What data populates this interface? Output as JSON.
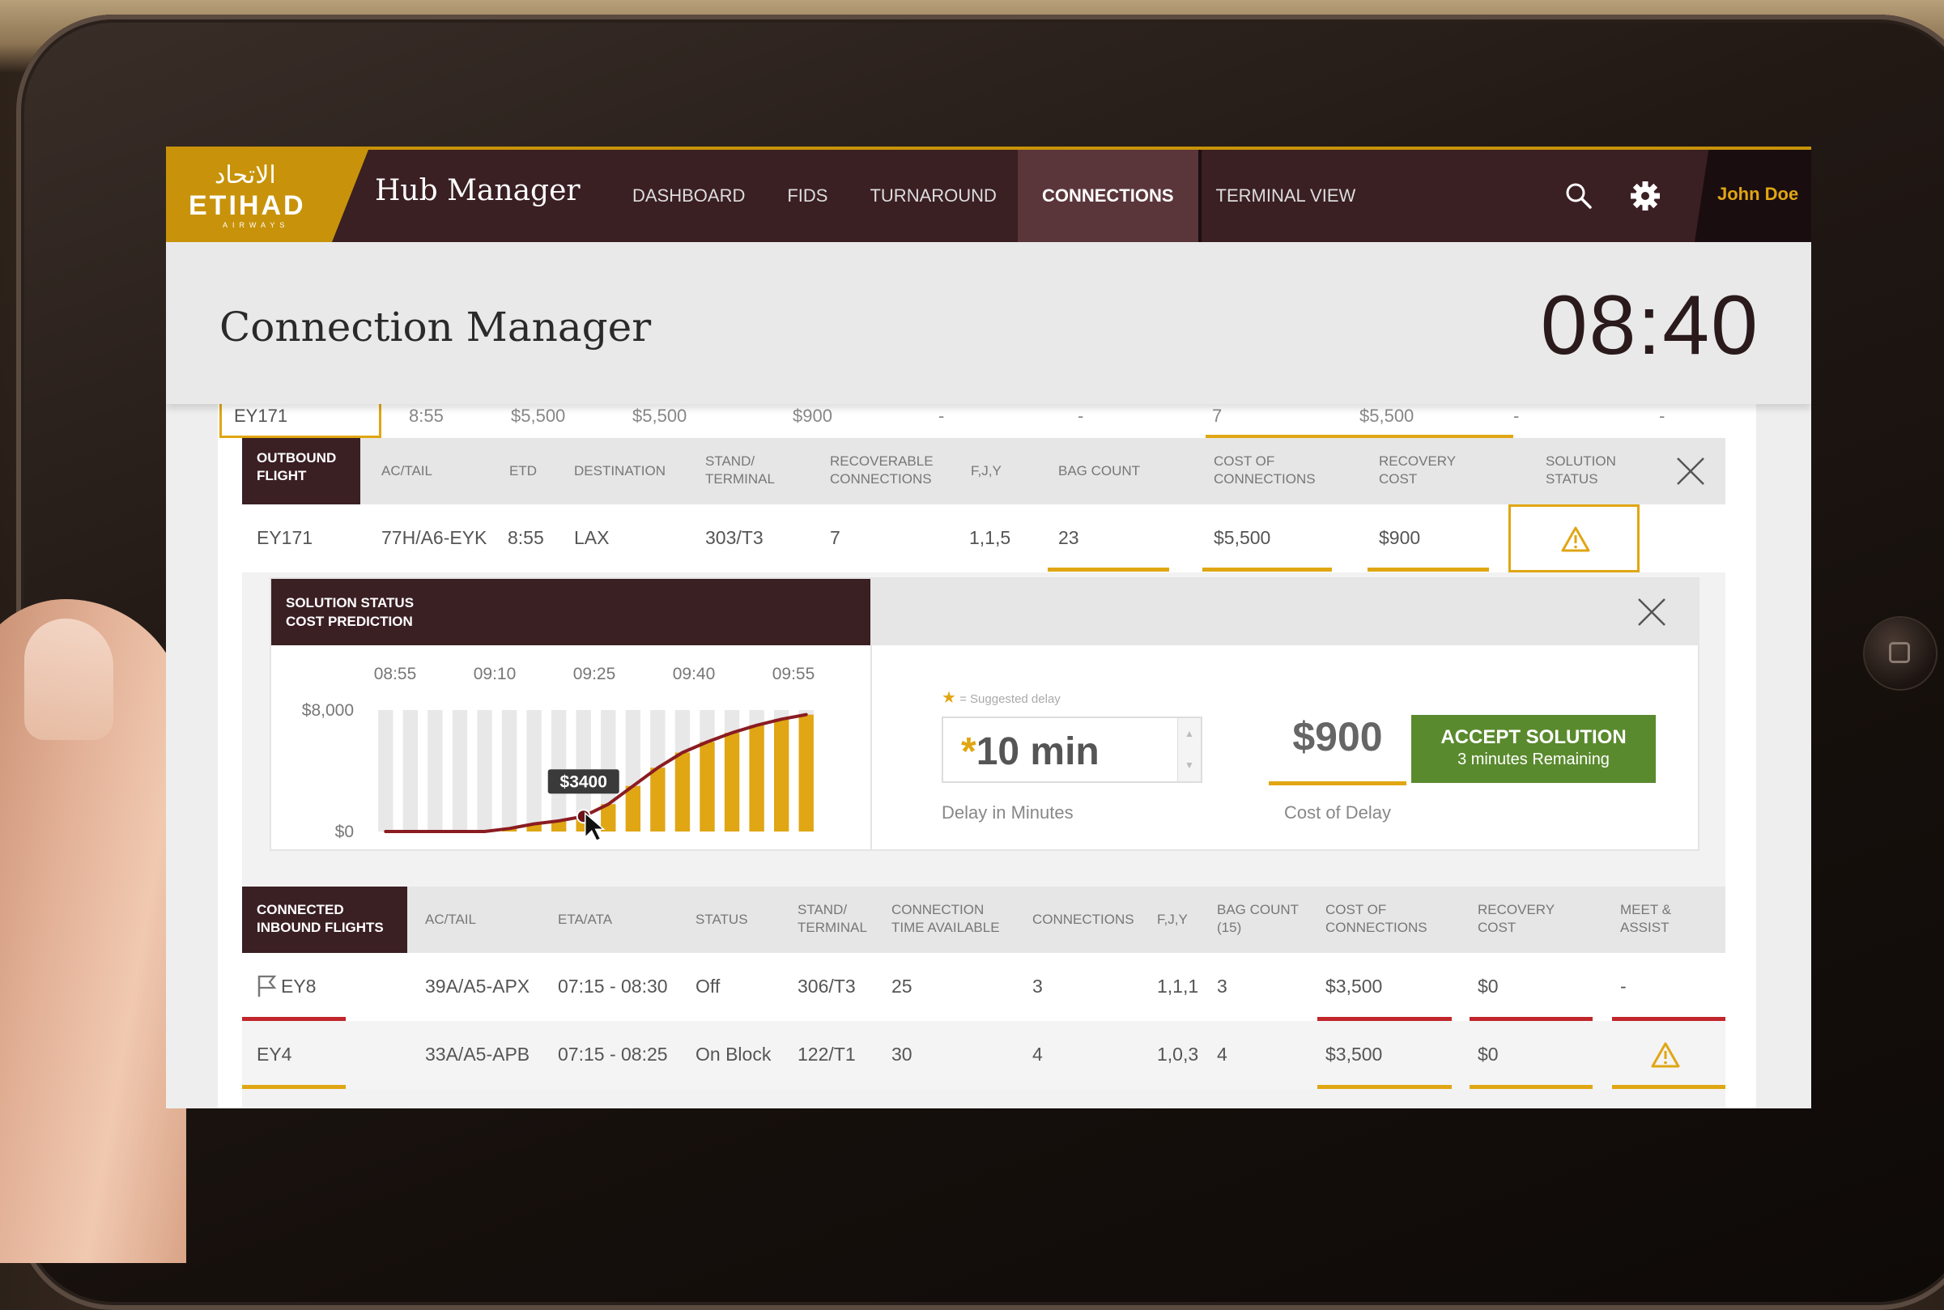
{
  "brand": {
    "logo_arabic": "الاتحاد",
    "logo_text": "ETIHAD",
    "logo_sub": "AIRWAYS",
    "app_name": "Hub Manager",
    "accent": "#c8930a"
  },
  "nav": {
    "items": [
      "DASHBOARD",
      "FIDS",
      "TURNAROUND",
      "CONNECTIONS",
      "TERMINAL VIEW"
    ],
    "active": "CONNECTIONS",
    "user": "John Doe"
  },
  "header": {
    "title": "Connection Manager",
    "time": "08:40"
  },
  "summary_row": [
    "EY171",
    "8:55",
    "$5,500",
    "$5,500",
    "$900",
    "-",
    "-",
    "7",
    "$5,500",
    "-",
    "-"
  ],
  "outbound": {
    "headers": [
      "OUTBOUND FLIGHT",
      "AC/TAIL",
      "ETD",
      "DESTINATION",
      "STAND/ TERMINAL",
      "RECOVERABLE CONNECTIONS",
      "F,J,Y",
      "BAG COUNT",
      "COST OF CONNECTIONS",
      "RECOVERY COST",
      "SOLUTION STATUS"
    ],
    "row": [
      "EY171",
      "77H/A6-EYK",
      "8:55",
      "LAX",
      "303/T3",
      "7",
      "1,1,5",
      "23",
      "$5,500",
      "$900"
    ]
  },
  "solution": {
    "title_line1": "SOLUTION STATUS",
    "title_line2": "COST PREDICTION",
    "legend_star": "★",
    "legend_text": "= Suggested delay",
    "delay_star": "*",
    "delay_value": "10 min",
    "delay_label": "Delay in Minutes",
    "cost_value": "$900",
    "cost_label": "Cost of Delay",
    "accept_label": "ACCEPT SOLUTION",
    "accept_sub": "3 minutes Remaining"
  },
  "chart_data": {
    "type": "bar",
    "x_ticks": [
      "08:55",
      "09:10",
      "09:25",
      "09:40",
      "09:55"
    ],
    "y_ticks": [
      "$8,000",
      "$0"
    ],
    "ylim": [
      0,
      8000
    ],
    "bar_count": 18,
    "values": [
      0,
      0,
      0,
      0,
      0,
      200,
      500,
      700,
      1000,
      1800,
      3000,
      4200,
      5200,
      5900,
      6500,
      7000,
      7400,
      7700
    ],
    "callout": "$3400",
    "callout_index": 8,
    "colors": {
      "bar": "#e0a613",
      "background_bar": "#e8e8e8",
      "curve": "#8a1c22"
    }
  },
  "inbound": {
    "headers": [
      "CONNECTED INBOUND FLIGHTS",
      "AC/TAIL",
      "ETA/ATA",
      "STATUS",
      "STAND/ TERMINAL",
      "CONNECTION TIME AVAILABLE",
      "CONNECTIONS",
      "F,J,Y",
      "BAG COUNT (15)",
      "COST OF CONNECTIONS",
      "RECOVERY COST",
      "MEET & ASSIST"
    ],
    "rows": [
      [
        "EY8",
        "39A/A5-APX",
        "07:15 - 08:30",
        "Off",
        "306/T3",
        "25",
        "3",
        "1,1,1",
        "3",
        "$3,500",
        "$0",
        "-"
      ],
      [
        "EY4",
        "33A/A5-APB",
        "07:15 - 08:25",
        "On Block",
        "122/T1",
        "30",
        "4",
        "1,0,3",
        "4",
        "$3,500",
        "$0",
        ""
      ]
    ]
  }
}
